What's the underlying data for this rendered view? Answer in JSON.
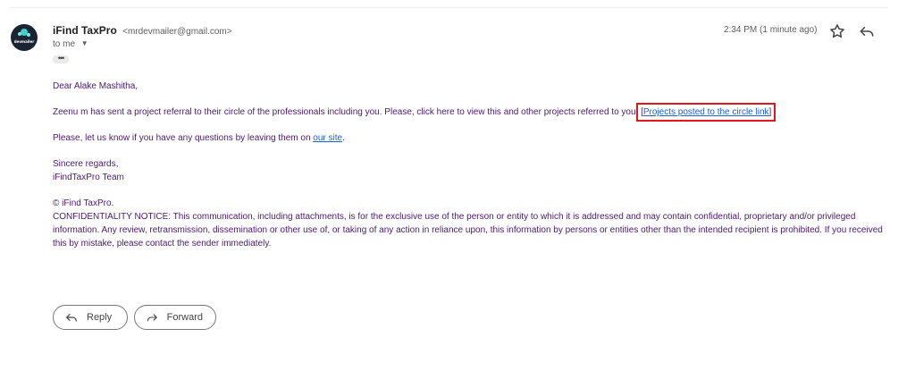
{
  "email": {
    "sender_name": "iFind TaxPro",
    "sender_email": "<mrdevmailer@gmail.com>",
    "recipient": "to me",
    "timestamp": "2:34 PM (1 minute ago)",
    "avatar_text": "devmailer",
    "greeting": "Dear Alake Mashitha,",
    "paragraph1": "Zeenu m has sent a project referral to their circle of the professionals including you. Please, click here to view this and other projects referred to you.",
    "link_open": "[",
    "link_text": "Projects posted to the circle link",
    "link_close": "]",
    "paragraph2_prefix": "Please, let us know if you have any questions by leaving them on",
    "site_link": "our site",
    "paragraph2_suffix": ".",
    "signoff": "Sincere regards,",
    "team": "iFindTaxPro Team",
    "copyright": "© iFind TaxPro.",
    "notice": "CONFIDENTIALITY NOTICE: This communication, including attachments, is for the exclusive use of the person or entity to which it is addressed and may contain confidential, proprietary and/or privileged information. Any review, retransmission, dissemination or other use of, or taking of any action in reliance upon, this information by persons or entities other than the intended recipient is prohibited. If you received this by mistake, please contact the sender immediately."
  },
  "actions": {
    "reply_label": "Reply",
    "forward_label": "Forward"
  },
  "icons": [
    "star-icon",
    "reply-icon",
    "forward-icon",
    "chevron-down-icon",
    "more-icon"
  ],
  "colors": {
    "body_text": "#4a1a6b",
    "link": "#1a5fd0",
    "highlight_box": "#e01818"
  }
}
